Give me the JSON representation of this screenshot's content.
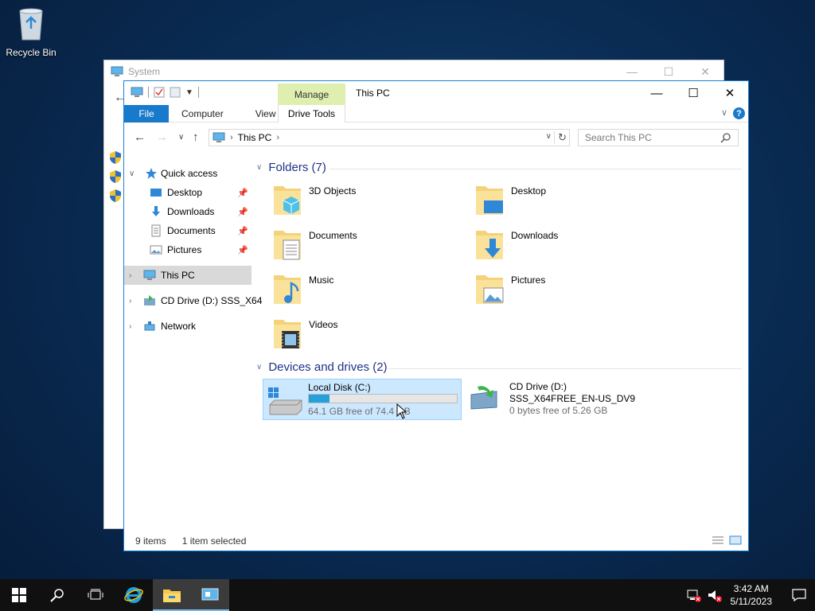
{
  "desktop": {
    "recycle_bin_label": "Recycle Bin"
  },
  "background_window": {
    "title": "System"
  },
  "window": {
    "title": "This PC",
    "contextual_tab_group": "Manage",
    "ribbon_tabs": {
      "file": "File",
      "computer": "Computer",
      "view": "View",
      "drive_tools": "Drive Tools"
    },
    "address": {
      "crumb": "This PC"
    },
    "search": {
      "placeholder": "Search This PC"
    }
  },
  "nav_pane": {
    "quick_access": "Quick access",
    "items": [
      {
        "label": "Desktop",
        "pinned": true
      },
      {
        "label": "Downloads",
        "pinned": true
      },
      {
        "label": "Documents",
        "pinned": true
      },
      {
        "label": "Pictures",
        "pinned": true
      }
    ],
    "this_pc": "This PC",
    "cd_drive": "CD Drive (D:) SSS_X64",
    "network": "Network"
  },
  "content": {
    "folders_header": "Folders (7)",
    "folders": [
      {
        "name": "3D Objects",
        "icon": "3d-objects-icon"
      },
      {
        "name": "Desktop",
        "icon": "desktop-folder-icon"
      },
      {
        "name": "Documents",
        "icon": "documents-folder-icon"
      },
      {
        "name": "Downloads",
        "icon": "downloads-folder-icon"
      },
      {
        "name": "Music",
        "icon": "music-folder-icon"
      },
      {
        "name": "Pictures",
        "icon": "pictures-folder-icon"
      },
      {
        "name": "Videos",
        "icon": "videos-folder-icon"
      }
    ],
    "devices_header": "Devices and drives (2)",
    "drives": [
      {
        "name": "Local Disk (C:)",
        "free_text": "64.1 GB free of 74.4 GB",
        "used_fraction": 0.14,
        "selected": true
      },
      {
        "name": "CD Drive (D:)",
        "label": "SSS_X64FREE_EN-US_DV9",
        "free_text": "0 bytes free of 5.26 GB",
        "selected": false
      }
    ]
  },
  "status": {
    "items": "9 items",
    "selected": "1 item selected"
  },
  "taskbar": {
    "time": "3:42 AM",
    "date": "5/11/2023"
  },
  "colors": {
    "accent": "#1979ca",
    "manage_tab": "#dfefb0",
    "selection": "#cce8ff",
    "progress": "#26a0da"
  }
}
